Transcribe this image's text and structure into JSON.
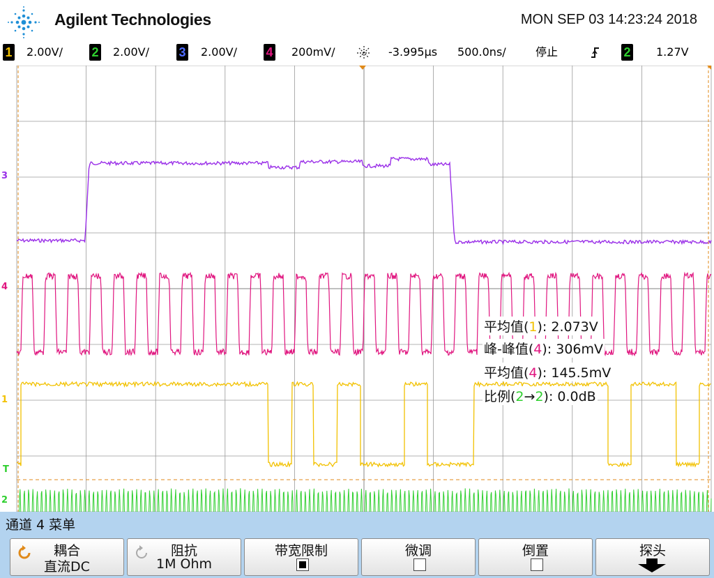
{
  "header": {
    "brand": "Agilent Technologies",
    "datetime": "MON SEP 03 14:23:24 2018"
  },
  "status": {
    "ch1": {
      "num": "1",
      "scale": "2.00V/",
      "color": "#f2c100"
    },
    "ch2": {
      "num": "2",
      "scale": "2.00V/",
      "color": "#2fcf2f"
    },
    "ch3": {
      "num": "3",
      "scale": "2.00V/",
      "color": "#4f6cff"
    },
    "ch4": {
      "num": "4",
      "scale": "200mV/",
      "color": "#e0157f"
    },
    "delay": "-3.995µs",
    "timebase": "500.0ns/",
    "run_state": "停止",
    "trigger_edge": "rising-edge-icon",
    "trigger_ch": "2",
    "trigger_level": "1.27V"
  },
  "markers": {
    "ch3": "3",
    "ch4": "4",
    "ch1": "1",
    "trigger": "T",
    "ch2": "2"
  },
  "measurements": {
    "m1_label": "平均值(",
    "m1_ch": "1",
    "m1_value": "): 2.073V",
    "m2_label": "峰-峰值(",
    "m2_ch": "4",
    "m2_value": "): 306mV",
    "m3_label": "平均值(",
    "m3_ch": "4",
    "m3_value": "): 145.5mV",
    "m4_label": "比例(",
    "m4_ch_a": "2",
    "m4_arrow": "→",
    "m4_ch_b": "2",
    "m4_value": "): 0.0dB"
  },
  "menu": {
    "title": "通道 4 菜单",
    "softkeys": [
      {
        "top": "耦合",
        "bottom": "直流DC"
      },
      {
        "top": "阻抗",
        "bottom": "1M Ohm"
      },
      {
        "top": "带宽限制",
        "checked": true
      },
      {
        "top": "微调",
        "checked": false
      },
      {
        "top": "倒置",
        "checked": false
      },
      {
        "top": "探头"
      }
    ]
  },
  "colors": {
    "ch1": "#f2c100",
    "ch2": "#2fcf2f",
    "ch3": "#9a2fe8",
    "ch4": "#e0157f",
    "trigger_marker": "#e08a1a",
    "grid": "#9a9a9a"
  }
}
